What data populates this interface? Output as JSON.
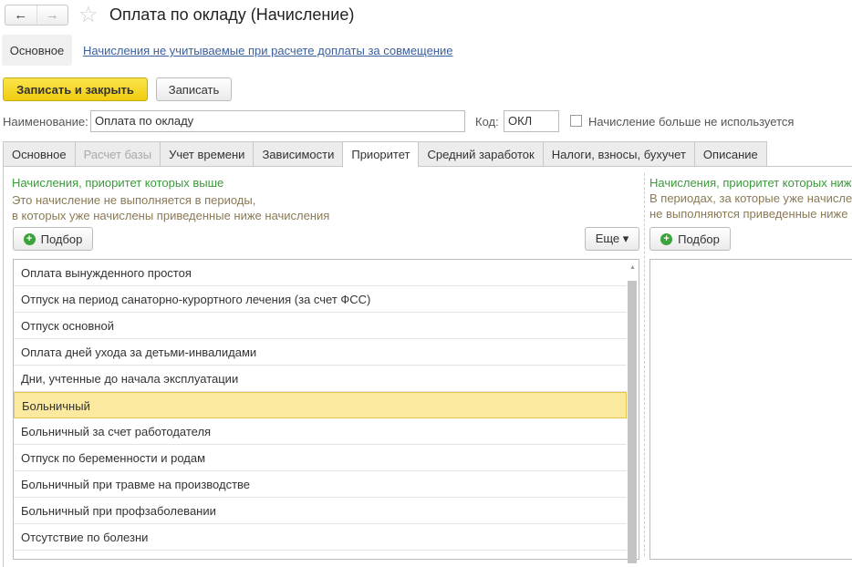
{
  "window": {
    "title": "Оплата по окладу (Начисление)",
    "back": "←",
    "forward": "→",
    "star": "☆"
  },
  "sections": {
    "main": "Основное",
    "link": "Начисления не учитываемые при расчете доплаты за совмещение"
  },
  "toolbar": {
    "save_close": "Записать и закрыть",
    "save": "Записать"
  },
  "form": {
    "name_label": "Наименование:",
    "name_value": "Оплата по окладу",
    "code_label": "Код:",
    "code_value": "ОКЛ",
    "unused_label": "Начисление больше не используется",
    "unused_checked": false
  },
  "tabs": [
    "Основное",
    "Расчет базы",
    "Учет времени",
    "Зависимости",
    "Приоритет",
    "Средний заработок",
    "Налоги, взносы, бухучет",
    "Описание"
  ],
  "left": {
    "heading": "Начисления, приоритет которых выше",
    "desc1": "Это начисление не выполняется в периоды,",
    "desc2": "в которых уже начислены приведенные ниже начисления",
    "pick": "Подбор",
    "more": "Еще ▾",
    "items": [
      "Оплата вынужденного простоя",
      "Отпуск на период санаторно-курортного лечения (за счет ФСС)",
      "Отпуск основной",
      "Оплата дней ухода за детьми-инвалидами",
      "Дни, учтенные до начала эксплуатации",
      "Больничный",
      "Больничный за счет работодателя",
      "Отпуск по беременности и родам",
      "Больничный при травме на производстве",
      "Больничный при профзаболевании",
      "Отсутствие по болезни"
    ],
    "selected_index": 5
  },
  "right": {
    "heading": "Начисления, приоритет которых ниже",
    "desc1": "В периодах, за которые уже начисле",
    "desc2": "не выполняются приведенные ниже",
    "pick": "Подбор"
  }
}
